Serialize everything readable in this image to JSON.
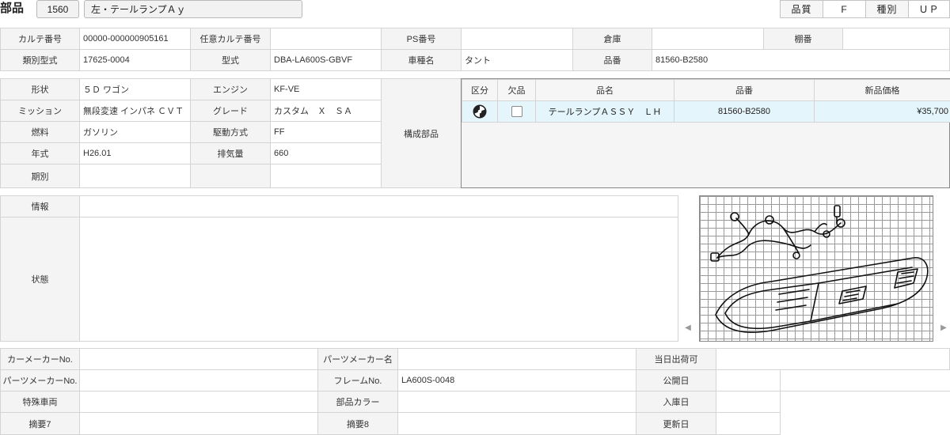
{
  "header": {
    "title": "部品",
    "code": "1560",
    "part_name": "左・テールランプＡｙ",
    "quality_label": "品質",
    "quality_value": "F",
    "kind_label": "種別",
    "kind_value": "ＵＰ"
  },
  "row1": {
    "karte_label": "カルテ番号",
    "karte_value": "00000-000000905161",
    "opt_karte_label": "任意カルテ番号",
    "opt_karte_value": "",
    "ps_label": "PS番号",
    "ps_value": "",
    "warehouse_label": "倉庫",
    "warehouse_value": "",
    "shelf_label": "棚番",
    "shelf_value": ""
  },
  "row2": {
    "class_label": "類別型式",
    "class_value": "17625-0004",
    "model_label": "型式",
    "model_value": "DBA-LA600S-GBVF",
    "car_label": "車種名",
    "car_value": "タント",
    "partno_label": "品番",
    "partno_value": "81560-B2580"
  },
  "vehicle": {
    "shape_label": "形状",
    "shape_value": "５Ｄ ワゴン",
    "engine_label": "エンジン",
    "engine_value": "KF-VE",
    "mission_label": "ミッション",
    "mission_value": "無段変速 インパネ ＣＶＴ",
    "grade_label": "グレード",
    "grade_value": "カスタム　Ｘ　ＳＡ",
    "fuel_label": "燃料",
    "fuel_value": "ガソリン",
    "drive_label": "駆動方式",
    "drive_value": "FF",
    "year_label": "年式",
    "year_value": "H26.01",
    "displacement_label": "排気量",
    "displacement_value": "660",
    "period_label": "期別",
    "period_value": "",
    "components_label": "構成部品"
  },
  "components_table": {
    "headers": [
      "区分",
      "欠品",
      "品名",
      "品番",
      "新品価格"
    ],
    "rows": [
      {
        "name": "テールランプＡＳＳＹ　ＬＨ",
        "part_no": "81560-B2580",
        "price": "¥35,700"
      }
    ]
  },
  "info": {
    "info_label": "情報",
    "info_value": "",
    "status_label": "状態",
    "status_value": ""
  },
  "bottom": {
    "maker_no_label": "カーメーカーNo.",
    "maker_no_value": "",
    "parts_maker_name_label": "パーツメーカー名",
    "parts_maker_name_value": "",
    "ship_today_label": "当日出荷可",
    "ship_today_value": "",
    "parts_maker_no_label": "パーツメーカーNo.",
    "parts_maker_no_value": "",
    "frame_label": "フレームNo.",
    "frame_value": "LA600S-0048",
    "publish_label": "公開日",
    "publish_value": "",
    "special_label": "特殊車両",
    "special_value": "",
    "color_label": "部品カラー",
    "color_value": "",
    "arrival_label": "入庫日",
    "arrival_value": "",
    "memo7_label": "摘要7",
    "memo7_value": "",
    "memo8_label": "摘要8",
    "memo8_value": "",
    "update_label": "更新日",
    "update_value": ""
  }
}
